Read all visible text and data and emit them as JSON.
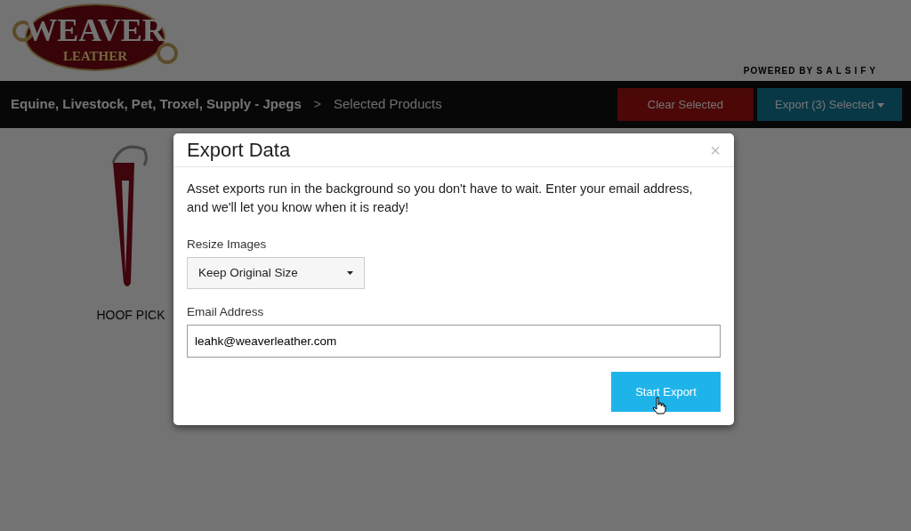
{
  "logo": {
    "title": "WEAVER",
    "subtitle": "LEATHER"
  },
  "powered_by": {
    "label": "POWERED BY",
    "brand": "SALSIFY"
  },
  "breadcrumb": [
    {
      "label": "Equine, Livestock, Pet, Troxel, Supply - Jpegs",
      "current": false
    },
    {
      "label": "Selected Products",
      "current": true
    }
  ],
  "breadcrumb_separator": ">",
  "actions": [
    {
      "label": "Clear Selected",
      "kind": "danger",
      "caret": false
    },
    {
      "label": "Export (3) Selected",
      "kind": "info",
      "caret": true
    }
  ],
  "products": [
    {
      "name": "HOOF PICK",
      "kind": "picture"
    }
  ],
  "modal": {
    "title": "Export Data",
    "close": "×",
    "message": "Asset exports run in the background so you don't have to wait. Enter your email address, and we'll let you know when it is ready!",
    "resize": {
      "label": "Resize Images",
      "value": "Keep Original Size"
    },
    "email": {
      "label": "Email Address",
      "value": "leahk@weaverleather.com"
    },
    "submit": "Start Export"
  }
}
